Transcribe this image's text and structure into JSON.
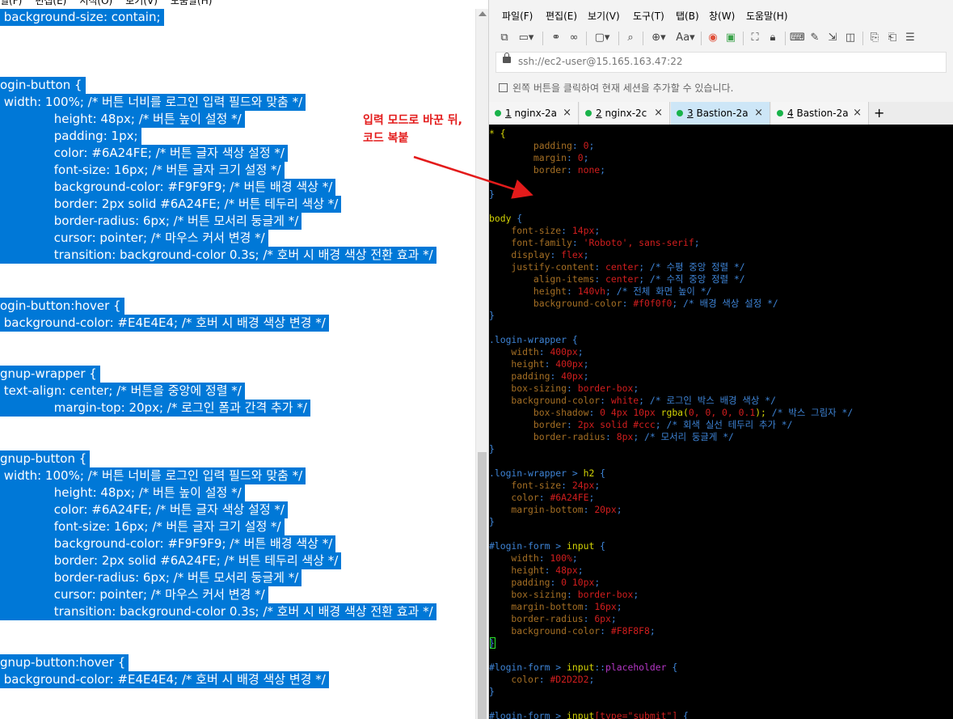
{
  "notepad": {
    "menu": [
      "일(F)",
      "편집(E)",
      "서식(O)",
      "보기(V)",
      "도움말(H)"
    ],
    "lines": [
      " background-size: contain;",
      "",
      "",
      "",
      "ogin-button {",
      " width: 100%; /* 버튼 너비를 로그인 입력 필드와 맞춤 */",
      "              height: 48px; /* 버튼 높이 설정 */",
      "              padding: 1px;",
      "              color: #6A24FE; /* 버튼 글자 색상 설정 */",
      "              font-size: 16px; /* 버튼 글자 크기 설정 */",
      "              background-color: #F9F9F9; /* 버튼 배경 색상 */",
      "              border: 2px solid #6A24FE; /* 버튼 테두리 색상 */",
      "              border-radius: 6px; /* 버튼 모서리 둥글게 */",
      "              cursor: pointer; /* 마우스 커서 변경 */",
      "              transition: background-color 0.3s; /* 호버 시 배경 색상 전환 효과 */",
      "",
      "",
      "ogin-button:hover {",
      " background-color: #E4E4E4; /* 호버 시 배경 색상 변경 */",
      "",
      "",
      "gnup-wrapper {",
      " text-align: center; /* 버튼을 중앙에 정렬 */",
      "              margin-top: 20px; /* 로그인 폼과 간격 추가 */",
      "",
      "",
      "gnup-button {",
      " width: 100%; /* 버튼 너비를 로그인 입력 필드와 맞춤 */",
      "              height: 48px; /* 버튼 높이 설정 */",
      "              color: #6A24FE; /* 버튼 글자 색상 설정 */",
      "              font-size: 16px; /* 버튼 글자 크기 설정 */",
      "              background-color: #F9F9F9; /* 버튼 배경 색상 */",
      "              border: 2px solid #6A24FE; /* 버튼 테두리 색상 */",
      "              border-radius: 6px; /* 버튼 모서리 둥글게 */",
      "              cursor: pointer; /* 마우스 커서 변경 */",
      "              transition: background-color 0.3s; /* 호버 시 배경 색상 전환 효과 */",
      "",
      "",
      "gnup-button:hover {",
      " background-color: #E4E4E4; /* 호버 시 배경 색상 변경 */",
      ""
    ]
  },
  "xshell": {
    "menu": [
      "파일(F)",
      "편집(E)",
      "보기(V)",
      "도구(T)",
      "탭(B)",
      "창(W)",
      "도움말(H)"
    ],
    "toolbar": {
      "font_label": "Aa"
    },
    "address": "ssh://ec2-user@15.165.163.47:22",
    "hint": "왼쪽 버튼을 클릭하여 현재 세션을 추가할 수 있습니다.",
    "tabs": [
      {
        "num": "1",
        "name": "nginx-2a",
        "active": false
      },
      {
        "num": "2",
        "name": "nginx-2c",
        "active": false
      },
      {
        "num": "3",
        "name": "Bastion-2a",
        "active": true
      },
      {
        "num": "4",
        "name": "Bastion-2a",
        "active": false
      }
    ],
    "tab_close": "×",
    "tab_add": "+",
    "terminal_lines": [
      [
        [
          "* {",
          "c-sel"
        ]
      ],
      [
        [
          "        padding",
          "c-prop"
        ],
        [
          ": ",
          "c-brace"
        ],
        [
          "0",
          "c-val"
        ],
        [
          ";",
          "c-brace"
        ]
      ],
      [
        [
          "        margin",
          "c-prop"
        ],
        [
          ": ",
          "c-brace"
        ],
        [
          "0",
          "c-val"
        ],
        [
          ";",
          "c-brace"
        ]
      ],
      [
        [
          "        border",
          "c-prop"
        ],
        [
          ": ",
          "c-brace"
        ],
        [
          "none",
          "c-val"
        ],
        [
          ";",
          "c-brace"
        ]
      ],
      [
        [
          "",
          "c-brace"
        ]
      ],
      [
        [
          "}",
          "c-brace"
        ]
      ],
      [
        [
          "",
          "c-brace"
        ]
      ],
      [
        [
          "body ",
          "c-sel"
        ],
        [
          "{",
          "c-brace"
        ]
      ],
      [
        [
          "    font-size",
          "c-prop"
        ],
        [
          ": ",
          "c-brace"
        ],
        [
          "14px",
          "c-val"
        ],
        [
          ";",
          "c-brace"
        ]
      ],
      [
        [
          "    font-family",
          "c-prop"
        ],
        [
          ": ",
          "c-brace"
        ],
        [
          "'Roboto', sans-serif",
          "c-val"
        ],
        [
          ";",
          "c-brace"
        ]
      ],
      [
        [
          "    display",
          "c-prop"
        ],
        [
          ": ",
          "c-brace"
        ],
        [
          "flex",
          "c-val"
        ],
        [
          ";",
          "c-brace"
        ]
      ],
      [
        [
          "    justify-content",
          "c-prop"
        ],
        [
          ": ",
          "c-brace"
        ],
        [
          "center",
          "c-val"
        ],
        [
          "; ",
          "c-brace"
        ],
        [
          "/* 수평 중앙 정렬 */",
          "c-cmt"
        ]
      ],
      [
        [
          "        align-items",
          "c-prop"
        ],
        [
          ": ",
          "c-brace"
        ],
        [
          "center",
          "c-val"
        ],
        [
          "; ",
          "c-brace"
        ],
        [
          "/* 수직 중앙 정렬 */",
          "c-cmt"
        ]
      ],
      [
        [
          "        height",
          "c-prop"
        ],
        [
          ": ",
          "c-brace"
        ],
        [
          "140vh",
          "c-val"
        ],
        [
          "; ",
          "c-brace"
        ],
        [
          "/* 전체 화면 높이 */",
          "c-cmt"
        ]
      ],
      [
        [
          "        background-color",
          "c-prop"
        ],
        [
          ": ",
          "c-brace"
        ],
        [
          "#f0f0f0",
          "c-val"
        ],
        [
          "; ",
          "c-brace"
        ],
        [
          "/* 배경 색상 설정 */",
          "c-cmt"
        ]
      ],
      [
        [
          "}",
          "c-brace"
        ]
      ],
      [
        [
          "",
          "c-brace"
        ]
      ],
      [
        [
          ".login-wrapper ",
          "c-id"
        ],
        [
          "{",
          "c-brace"
        ]
      ],
      [
        [
          "    width",
          "c-prop"
        ],
        [
          ": ",
          "c-brace"
        ],
        [
          "400px",
          "c-val"
        ],
        [
          ";",
          "c-brace"
        ]
      ],
      [
        [
          "    height",
          "c-prop"
        ],
        [
          ": ",
          "c-brace"
        ],
        [
          "400px",
          "c-val"
        ],
        [
          ";",
          "c-brace"
        ]
      ],
      [
        [
          "    padding",
          "c-prop"
        ],
        [
          ": ",
          "c-brace"
        ],
        [
          "40px",
          "c-val"
        ],
        [
          ";",
          "c-brace"
        ]
      ],
      [
        [
          "    box-sizing",
          "c-prop"
        ],
        [
          ": ",
          "c-brace"
        ],
        [
          "border-box",
          "c-val"
        ],
        [
          ";",
          "c-brace"
        ]
      ],
      [
        [
          "    background-color",
          "c-prop"
        ],
        [
          ": ",
          "c-brace"
        ],
        [
          "white",
          "c-val"
        ],
        [
          "; ",
          "c-brace"
        ],
        [
          "/* 로그인 박스 배경 색상 */",
          "c-cmt"
        ]
      ],
      [
        [
          "        box-shadow",
          "c-prop"
        ],
        [
          ": ",
          "c-brace"
        ],
        [
          "0 4px 10px ",
          "c-val"
        ],
        [
          "rgba(",
          "c-sel"
        ],
        [
          "0, 0, 0, 0.1",
          "c-val"
        ],
        [
          ");",
          "c-sel"
        ],
        [
          " /* 박스 그림자 */",
          "c-cmt"
        ]
      ],
      [
        [
          "        border",
          "c-prop"
        ],
        [
          ": ",
          "c-brace"
        ],
        [
          "2px solid #ccc",
          "c-val"
        ],
        [
          "; ",
          "c-brace"
        ],
        [
          "/* 회색 실선 테두리 추가 */",
          "c-cmt"
        ]
      ],
      [
        [
          "        border-radius",
          "c-prop"
        ],
        [
          ": ",
          "c-brace"
        ],
        [
          "8px",
          "c-val"
        ],
        [
          "; ",
          "c-brace"
        ],
        [
          "/* 모서리 둥글게 */",
          "c-cmt"
        ]
      ],
      [
        [
          "}",
          "c-brace"
        ]
      ],
      [
        [
          "",
          "c-brace"
        ]
      ],
      [
        [
          ".login-wrapper ",
          "c-id"
        ],
        [
          "> ",
          "c-brace"
        ],
        [
          "h2 ",
          "c-sel"
        ],
        [
          "{",
          "c-brace"
        ]
      ],
      [
        [
          "    font-size",
          "c-prop"
        ],
        [
          ": ",
          "c-brace"
        ],
        [
          "24px",
          "c-val"
        ],
        [
          ";",
          "c-brace"
        ]
      ],
      [
        [
          "    color",
          "c-prop"
        ],
        [
          ": ",
          "c-brace"
        ],
        [
          "#6A24FE",
          "c-val"
        ],
        [
          ";",
          "c-brace"
        ]
      ],
      [
        [
          "    margin-bottom",
          "c-prop"
        ],
        [
          ": ",
          "c-brace"
        ],
        [
          "20px",
          "c-val"
        ],
        [
          ";",
          "c-brace"
        ]
      ],
      [
        [
          "}",
          "c-brace"
        ]
      ],
      [
        [
          "",
          "c-brace"
        ]
      ],
      [
        [
          "#login-form ",
          "c-id"
        ],
        [
          "> ",
          "c-brace"
        ],
        [
          "input ",
          "c-sel"
        ],
        [
          "{",
          "c-brace"
        ]
      ],
      [
        [
          "    width",
          "c-prop"
        ],
        [
          ": ",
          "c-brace"
        ],
        [
          "100%",
          "c-val"
        ],
        [
          ";",
          "c-brace"
        ]
      ],
      [
        [
          "    height",
          "c-prop"
        ],
        [
          ": ",
          "c-brace"
        ],
        [
          "48px",
          "c-val"
        ],
        [
          ";",
          "c-brace"
        ]
      ],
      [
        [
          "    padding",
          "c-prop"
        ],
        [
          ": ",
          "c-brace"
        ],
        [
          "0 10px",
          "c-val"
        ],
        [
          ";",
          "c-brace"
        ]
      ],
      [
        [
          "    box-sizing",
          "c-prop"
        ],
        [
          ": ",
          "c-brace"
        ],
        [
          "border-box",
          "c-val"
        ],
        [
          ";",
          "c-brace"
        ]
      ],
      [
        [
          "    margin-bottom",
          "c-prop"
        ],
        [
          ": ",
          "c-brace"
        ],
        [
          "16px",
          "c-val"
        ],
        [
          ";",
          "c-brace"
        ]
      ],
      [
        [
          "    border-radius",
          "c-prop"
        ],
        [
          ": ",
          "c-brace"
        ],
        [
          "6px",
          "c-val"
        ],
        [
          ";",
          "c-brace"
        ]
      ],
      [
        [
          "    background-color",
          "c-prop"
        ],
        [
          ": ",
          "c-brace"
        ],
        [
          "#F8F8F8",
          "c-val"
        ],
        [
          ";",
          "c-brace"
        ]
      ],
      [
        [
          "}",
          "c-brace"
        ]
      ],
      [
        [
          "",
          "c-brace"
        ]
      ],
      [
        [
          "#login-form ",
          "c-id"
        ],
        [
          "> ",
          "c-brace"
        ],
        [
          "input",
          "c-sel"
        ],
        [
          "::",
          "c-brace"
        ],
        [
          "placeholder ",
          "c-pc"
        ],
        [
          "{",
          "c-brace"
        ]
      ],
      [
        [
          "    color",
          "c-prop"
        ],
        [
          ": ",
          "c-brace"
        ],
        [
          "#D2D2D2",
          "c-val"
        ],
        [
          ";",
          "c-brace"
        ]
      ],
      [
        [
          "}",
          "c-brace"
        ]
      ],
      [
        [
          "",
          "c-brace"
        ]
      ],
      [
        [
          "#login-form ",
          "c-id"
        ],
        [
          "> ",
          "c-brace"
        ],
        [
          "input",
          "c-sel"
        ],
        [
          "[type=\"submit\"]",
          "c-val"
        ],
        [
          " {",
          "c-brace"
        ]
      ]
    ]
  },
  "annotation": {
    "line1": "입력 모드로 바꾼 뒤,",
    "line2": "코드 복붙",
    "color": "#e31b1b"
  },
  "colors": {
    "selection": "#0078d7",
    "tab_active": "#cde6f7",
    "tab_dot": "#19b34a"
  }
}
